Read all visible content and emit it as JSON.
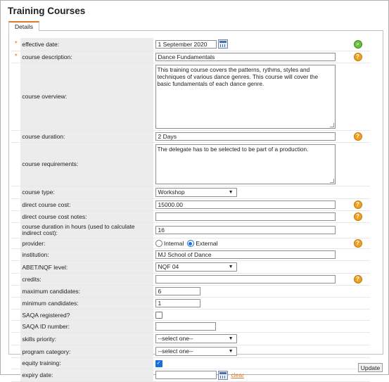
{
  "page": {
    "title": "Training Courses"
  },
  "tabs": [
    {
      "label": "Details"
    }
  ],
  "fields": {
    "effective_date": {
      "label": "effective date:",
      "value": "1 September 2020"
    },
    "course_description": {
      "label": "course description:",
      "value": "Dance Fundamentals"
    },
    "course_overview": {
      "label": "course overview:",
      "value": "This training course covers the patterns, rythms, styles and techniques of various dance genres. This course will cover the basic fundamentals of each dance genre."
    },
    "course_duration": {
      "label": "course duration:",
      "value": "2 Days"
    },
    "course_requirements": {
      "label": "course requirements:",
      "value": "The delegate has to be selected to be part of a production."
    },
    "course_type": {
      "label": "course type:",
      "value": "Workshop"
    },
    "direct_course_cost": {
      "label": "direct course cost:",
      "value": "15000.00"
    },
    "direct_course_cost_notes": {
      "label": "direct course cost notes:",
      "value": ""
    },
    "course_duration_hours": {
      "label": "course duration in hours (used to calculate indirect cost):",
      "value": "16"
    },
    "provider": {
      "label": "provider:",
      "options": [
        "Internal",
        "External"
      ],
      "selected": "External"
    },
    "institution": {
      "label": "institution:",
      "value": "MJ School of Dance"
    },
    "abet_nqf_level": {
      "label": "ABET/NQF level:",
      "value": "NQF 04"
    },
    "credits": {
      "label": "credits:",
      "value": ""
    },
    "maximum_candidates": {
      "label": "maximum candidates:",
      "value": "6"
    },
    "minimum_candidates": {
      "label": "minimum candidates:",
      "value": "1"
    },
    "saqa_registered": {
      "label": "SAQA registered?",
      "checked": false
    },
    "saqa_id_number": {
      "label": "SAQA ID number:",
      "value": ""
    },
    "skills_priority": {
      "label": "skills priority:",
      "value": "--select one--"
    },
    "program_category": {
      "label": "program category:",
      "value": "--select one--"
    },
    "equity_training": {
      "label": "equity training:",
      "checked": true
    },
    "expiry_date": {
      "label": "expiry date:",
      "value": "",
      "clear_label": "clear"
    }
  },
  "required_marker": "*",
  "icons": {
    "help": "help-icon",
    "search": "search-icon",
    "calendar": "calendar-icon",
    "checkmark": "✓"
  },
  "buttons": {
    "update": "Update"
  },
  "colors": {
    "accent": "#e07a2a",
    "help": "#f0a020",
    "search": "#6cbf3a",
    "label_bg": "#ececec"
  }
}
